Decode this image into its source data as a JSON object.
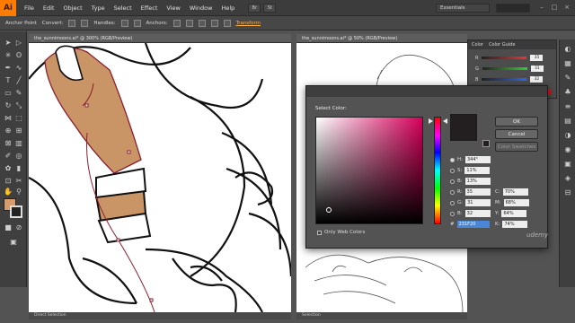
{
  "app": {
    "logo": "Ai"
  },
  "menus": [
    "File",
    "Edit",
    "Object",
    "Type",
    "Select",
    "Effect",
    "View",
    "Window",
    "Help"
  ],
  "bridge_icons": [
    "Br",
    "St"
  ],
  "workspace": "Essentials",
  "controlbar": {
    "anchor_label": "Anchor Point",
    "convert_label": "Convert:",
    "handles_label": "Handles:",
    "anchors_label": "Anchors:",
    "transform_link": "Transform"
  },
  "documents": [
    {
      "tab": "the_sunnimoons.ai* @ 300% (RGB/Preview)",
      "status": "Direct Selection"
    },
    {
      "tab": "the_sunnimoons.ai* @ 50% (RGB/Preview)",
      "status": "Selection"
    }
  ],
  "color_panel": {
    "tabs": [
      "Color",
      "Color Guide"
    ],
    "sliders": [
      {
        "label": "R",
        "value": "35",
        "color": "#e33"
      },
      {
        "label": "G",
        "value": "31",
        "color": "#3c3"
      },
      {
        "label": "B",
        "value": "32",
        "color": "#36e"
      }
    ]
  },
  "color_picker": {
    "heading": "Select Color:",
    "ok": "OK",
    "cancel": "Cancel",
    "swatches": "Color Swatches",
    "only_web_colors": "Only Web Colors",
    "hsb": [
      {
        "label": "H:",
        "value": "344°"
      },
      {
        "label": "S:",
        "value": "11%"
      },
      {
        "label": "B:",
        "value": "13%"
      }
    ],
    "rgb": [
      {
        "label": "R:",
        "value": "35"
      },
      {
        "label": "G:",
        "value": "31"
      },
      {
        "label": "B:",
        "value": "32"
      }
    ],
    "hex": {
      "label": "#",
      "value": "231F20"
    },
    "cmyk": [
      {
        "label": "C:",
        "value": "70%"
      },
      {
        "label": "M:",
        "value": "68%"
      },
      {
        "label": "Y:",
        "value": "64%"
      },
      {
        "label": "K:",
        "value": "74%"
      }
    ],
    "selected_color": "#231f20"
  },
  "watermark": "udemy"
}
